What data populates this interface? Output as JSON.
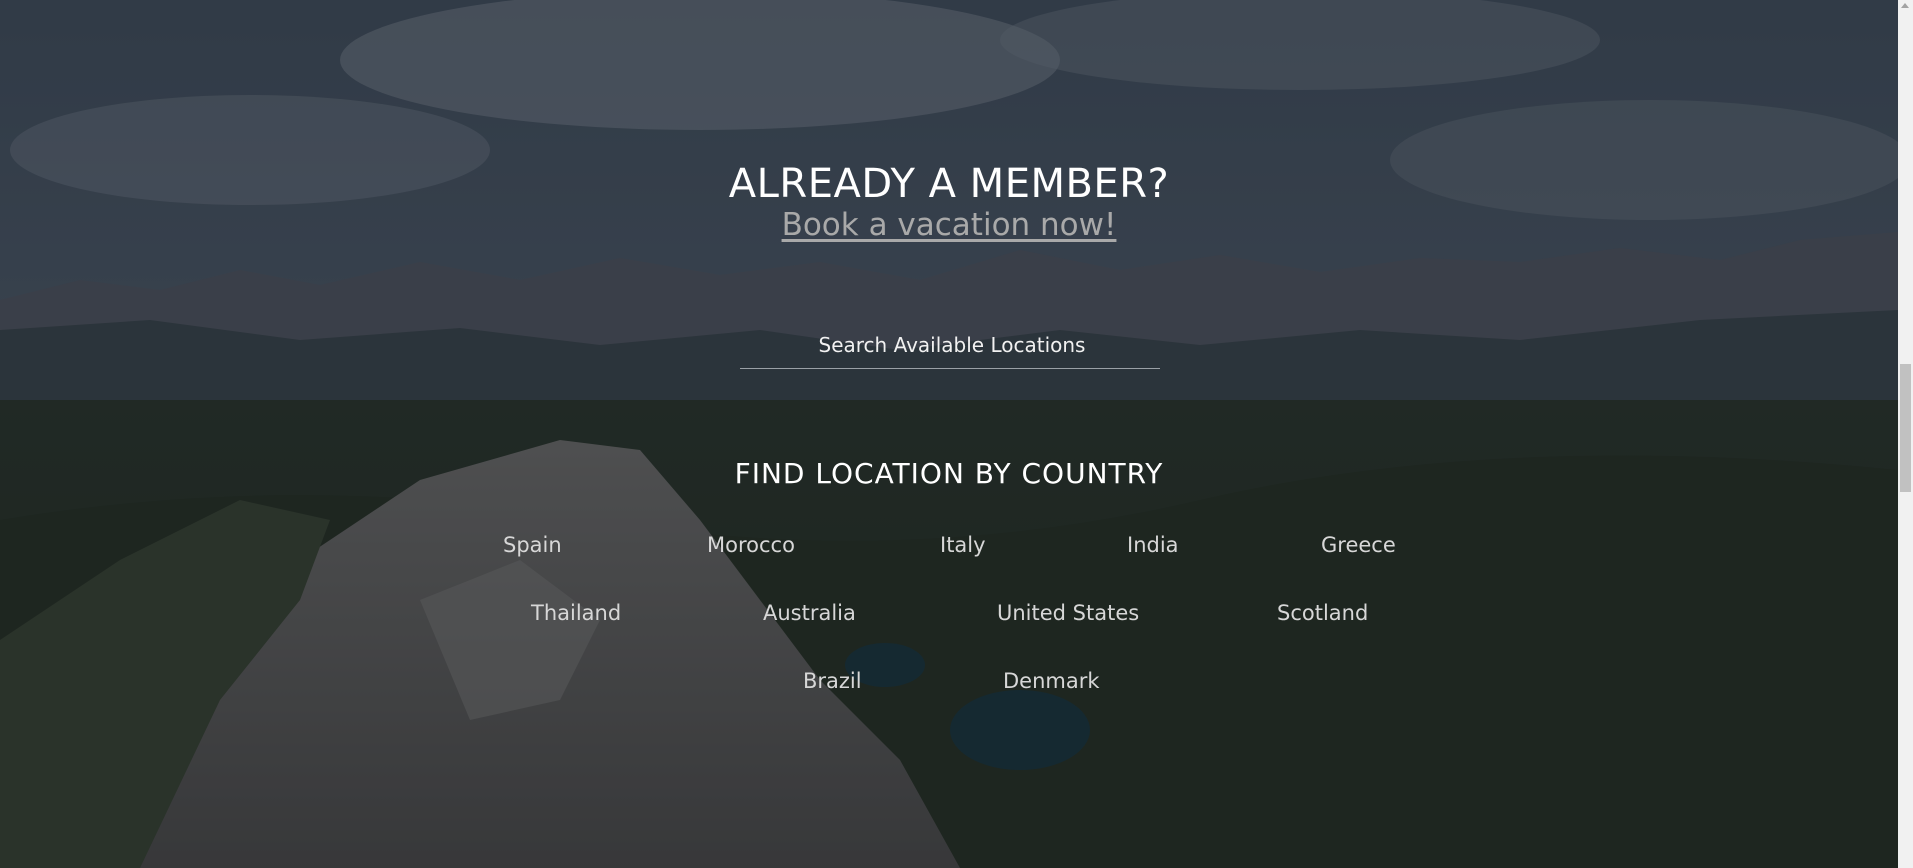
{
  "header": {
    "headline": "ALREADY A MEMBER?",
    "book_link": "Book a vacation now!"
  },
  "search": {
    "placeholder": "Search Available Locations"
  },
  "countries_section": {
    "title": "FIND LOCATION BY COUNTRY",
    "countries": [
      "Spain",
      "Morocco",
      "Italy",
      "India",
      "Greece",
      "Thailand",
      "Australia",
      "United States",
      "Scotland",
      "Brazil",
      "Denmark"
    ]
  },
  "colors": {
    "link": "#a9a9a9",
    "text": "#ffffff",
    "country_text": "#d7d7d7"
  }
}
